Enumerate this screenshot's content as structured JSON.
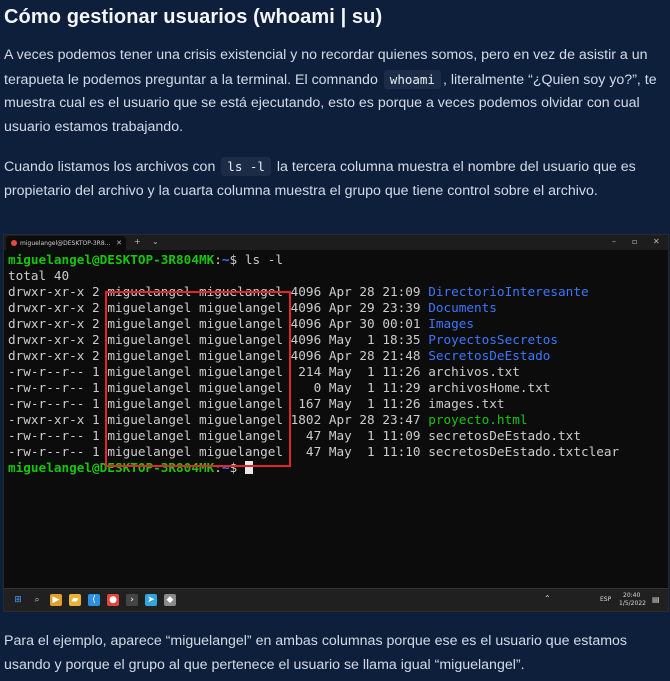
{
  "article": {
    "title": "Cómo gestionar usuarios (whoami | su)",
    "p1_a": "A veces podemos tener una crisis existencial y no recordar quienes somos, pero en vez de asistir a un terapueta le podemos preguntar a la terminal. El comnando",
    "p1_code": "whoami",
    "p1_b": ", literalmente “¿Quien soy yo?”, te muestra cual es el usuario que se está ejecutando, esto es porque a veces podemos olvidar con cual usuario estamos trabajando.",
    "p2_a": "Cuando listamos los archivos con",
    "p2_code": "ls -l",
    "p2_b": "la tercera columna muestra el nombre del usuario que es propietario del archivo y la cuarta columna muestra el grupo que tiene control sobre el archivo.",
    "p3": "Para el ejemplo, aparece “miguelangel” en ambas columnas porque ese es el usuario que estamos usando y porque el grupo al que pertenece el usuario se llama igual “miguelangel”."
  },
  "terminal_window": {
    "tab_title": "miguelangel@DESKTOP-3R8...",
    "tab_close": "✕",
    "new_tab": "+",
    "dropdown": "⌄",
    "minimize": "–",
    "maximize": "▫",
    "close": "✕"
  },
  "terminal": {
    "prompt_user": "miguelangel@DESKTOP-3R804MK",
    "prompt_sep": ":",
    "prompt_path": "~",
    "prompt_end": "$ ",
    "command": "ls -l",
    "total": "total 40",
    "entries": [
      {
        "perms": "drwxr-xr-x",
        "links": "2",
        "owner": "miguelangel",
        "group": "miguelangel",
        "size": "4096",
        "month": "Apr",
        "day": "28",
        "time": "21:09",
        "name": "DirectorioInteresante",
        "kind": "dir"
      },
      {
        "perms": "drwxr-xr-x",
        "links": "2",
        "owner": "miguelangel",
        "group": "miguelangel",
        "size": "4096",
        "month": "Apr",
        "day": "29",
        "time": "23:39",
        "name": "Documents",
        "kind": "dir"
      },
      {
        "perms": "drwxr-xr-x",
        "links": "2",
        "owner": "miguelangel",
        "group": "miguelangel",
        "size": "4096",
        "month": "Apr",
        "day": "30",
        "time": "00:01",
        "name": "Images",
        "kind": "dir"
      },
      {
        "perms": "drwxr-xr-x",
        "links": "2",
        "owner": "miguelangel",
        "group": "miguelangel",
        "size": "4096",
        "month": "May",
        "day": "1",
        "time": "18:35",
        "name": "ProyectosSecretos",
        "kind": "dir"
      },
      {
        "perms": "drwxr-xr-x",
        "links": "2",
        "owner": "miguelangel",
        "group": "miguelangel",
        "size": "4096",
        "month": "Apr",
        "day": "28",
        "time": "21:48",
        "name": "SecretosDeEstado",
        "kind": "dir"
      },
      {
        "perms": "-rw-r--r--",
        "links": "1",
        "owner": "miguelangel",
        "group": "miguelangel",
        "size": "214",
        "month": "May",
        "day": "1",
        "time": "11:26",
        "name": "archivos.txt",
        "kind": "file"
      },
      {
        "perms": "-rw-r--r--",
        "links": "1",
        "owner": "miguelangel",
        "group": "miguelangel",
        "size": "0",
        "month": "May",
        "day": "1",
        "time": "11:29",
        "name": "archivosHome.txt",
        "kind": "file"
      },
      {
        "perms": "-rw-r--r--",
        "links": "1",
        "owner": "miguelangel",
        "group": "miguelangel",
        "size": "167",
        "month": "May",
        "day": "1",
        "time": "11:26",
        "name": "images.txt",
        "kind": "file"
      },
      {
        "perms": "-rwxr-xr-x",
        "links": "1",
        "owner": "miguelangel",
        "group": "miguelangel",
        "size": "1802",
        "month": "Apr",
        "day": "28",
        "time": "23:47",
        "name": "proyecto.html",
        "kind": "exe"
      },
      {
        "perms": "-rw-r--r--",
        "links": "1",
        "owner": "miguelangel",
        "group": "miguelangel",
        "size": "47",
        "month": "May",
        "day": "1",
        "time": "11:09",
        "name": "secretosDeEstado.txt",
        "kind": "file"
      },
      {
        "perms": "-rw-r--r--",
        "links": "1",
        "owner": "miguelangel",
        "group": "miguelangel",
        "size": "47",
        "month": "May",
        "day": "1",
        "time": "11:10",
        "name": "secretosDeEstado.txtclear",
        "kind": "file"
      }
    ]
  },
  "taskbar": {
    "icons": [
      "windows-start-icon",
      "search-icon",
      "media-app-icon",
      "file-explorer-icon",
      "vscode-icon",
      "chrome-icon",
      "terminal-icon",
      "telegram-icon",
      "linux-app-icon"
    ],
    "tray_lang": "ESP",
    "time": "20:40",
    "date": "1/5/2022"
  },
  "colors": {
    "background": "#0d1f3a",
    "highlight": "#e3242b",
    "prompt_green": "#16c60c",
    "dir_blue": "#3b78ff"
  }
}
